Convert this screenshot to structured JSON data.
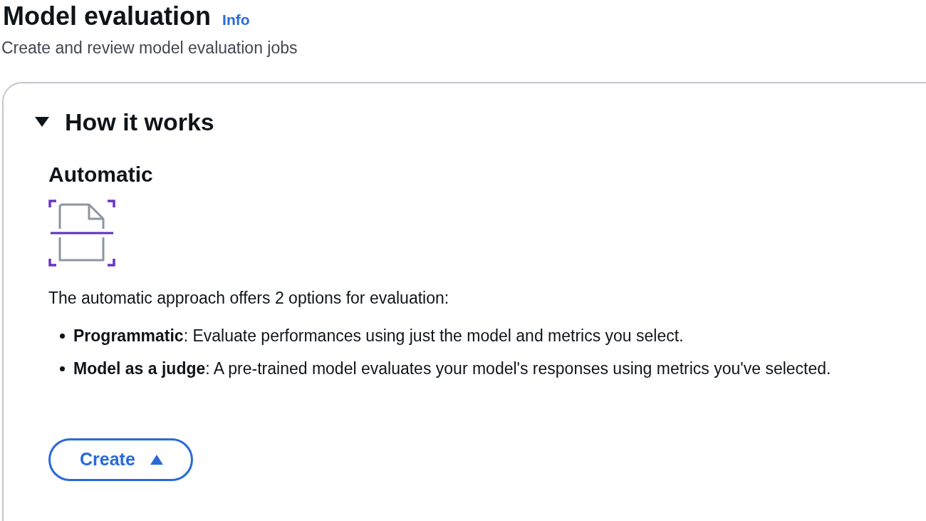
{
  "header": {
    "title": "Model evaluation",
    "info_link": "Info",
    "description": "Create and review model evaluation jobs"
  },
  "how_it_works": {
    "title": "How it works",
    "expanded": true,
    "section": {
      "title": "Automatic",
      "intro": "The automatic approach offers 2 options for evaluation:",
      "bullets": [
        "**Programmatic**: Evaluate performances using just the model and metrics you select.",
        "**Model as a judge**: A pre-trained model evaluates your model's responses using metrics you've selected."
      ]
    }
  },
  "create_button": {
    "label": "Create",
    "expanded": true
  }
}
